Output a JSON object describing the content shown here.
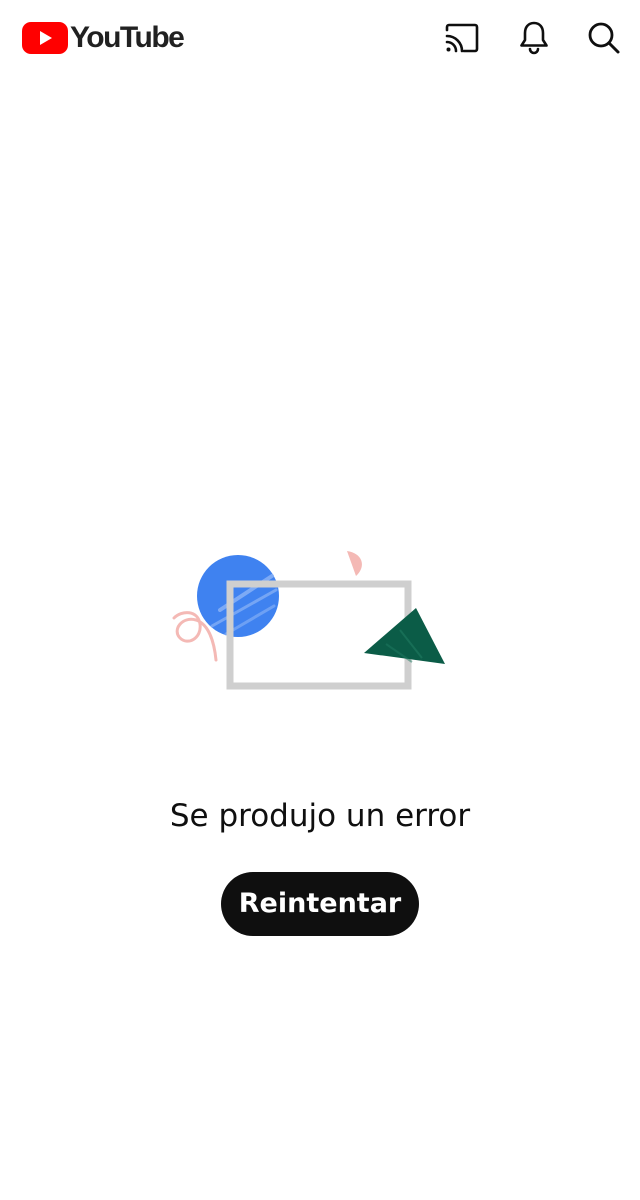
{
  "app": {
    "brand_name": "YouTube",
    "brand_color": "#ff0000",
    "text_color": "#0f0f0f"
  },
  "header": {
    "icons": [
      "cast-icon",
      "notifications-bell-icon",
      "search-icon"
    ]
  },
  "illustration": {
    "shapes": [
      "blue-circle",
      "pink-squiggle",
      "pink-half-circle",
      "gray-rectangle-frame",
      "green-triangle"
    ],
    "colors": {
      "blue": "#3f82f0",
      "pink": "#f4b9b5",
      "gray": "#cfcfcf",
      "green": "#0b5c47"
    }
  },
  "main": {
    "error_message": "Se produjo un error",
    "retry_label": "Reintentar"
  }
}
